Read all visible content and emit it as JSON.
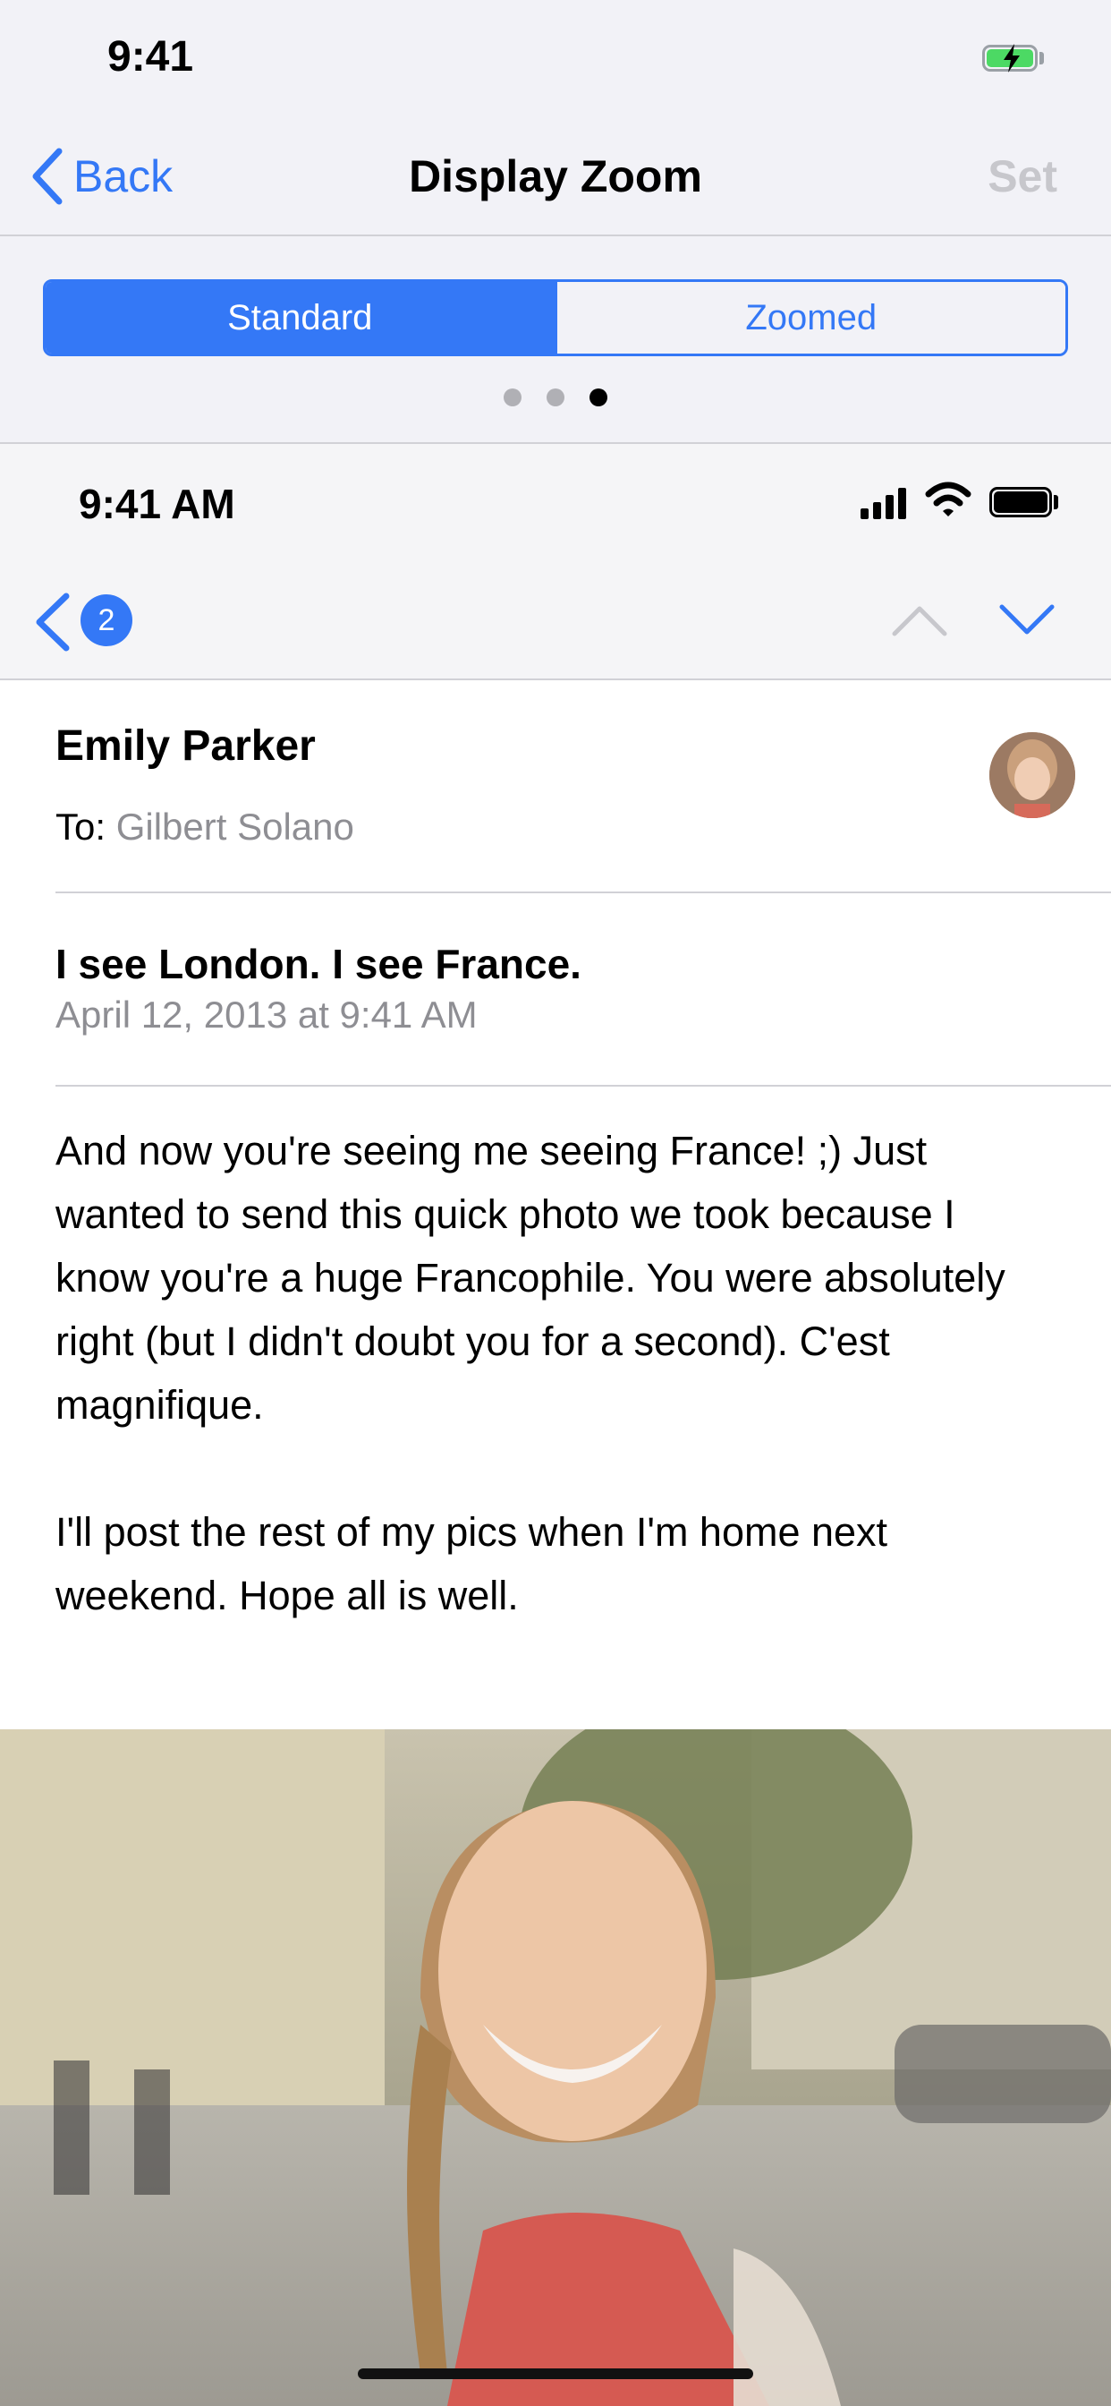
{
  "status_bar": {
    "time": "9:41"
  },
  "nav": {
    "back_label": "Back",
    "title": "Display Zoom",
    "set_label": "Set"
  },
  "zoom_control": {
    "options": [
      "Standard",
      "Zoomed"
    ],
    "selected": "Standard",
    "page_dots": 3,
    "current_dot": 3
  },
  "preview": {
    "status_bar": {
      "time": "9:41 AM"
    },
    "toolbar": {
      "unread_count": "2"
    },
    "message": {
      "sender": "Emily Parker",
      "to_label": "To:",
      "to_name": "Gilbert Solano",
      "subject": "I see London. I see France.",
      "date": "April 12, 2013 at 9:41 AM",
      "body": [
        "And now you're seeing me seeing France! ;) Just wanted to send this quick photo we took because I know you're a huge Francophile. You were absolutely right (but I didn't doubt you for a second). C'est magnifique.",
        "I'll post the rest of my pics when I'm home next weekend. Hope all is well."
      ]
    }
  },
  "colors": {
    "accent": "#3478f6",
    "secondary_text": "#8e8e93",
    "battery_charging": "#4cd964"
  }
}
